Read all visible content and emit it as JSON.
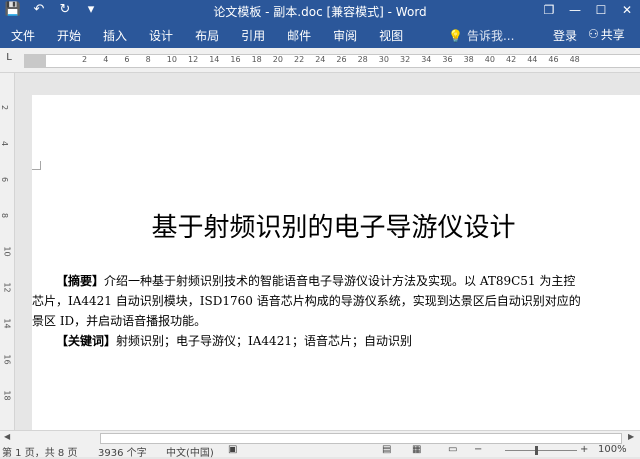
{
  "titlebar": {
    "title": "论文模板 - 副本.doc [兼容模式] - Word",
    "qat": {
      "save_icon": "💾",
      "undo_icon": "↶",
      "redo_icon": "↻",
      "custom_icon": "▾"
    },
    "controls": {
      "restore": "❐",
      "minimize": "—",
      "maximize": "☐",
      "close": "✕"
    }
  },
  "ribbon": {
    "tabs": [
      "文件",
      "开始",
      "插入",
      "设计",
      "布局",
      "引用",
      "邮件",
      "审阅",
      "视图"
    ],
    "tell_me": "告诉我...",
    "login": "登录",
    "share": "共享"
  },
  "ruler": {
    "numbers": [
      "2",
      "4",
      "6",
      "8",
      "10",
      "12",
      "14",
      "16",
      "18",
      "20",
      "22",
      "24",
      "26",
      "28",
      "30",
      "32",
      "34",
      "36",
      "38",
      "40",
      "42",
      "44",
      "46",
      "48"
    ],
    "v_numbers": [
      "2",
      "4",
      "6",
      "8",
      "10",
      "12",
      "14",
      "16",
      "18"
    ]
  },
  "document": {
    "title": "基于射频识别的电子导游仪设计",
    "abstract_label": "【摘要】",
    "abstract_line1": "介绍一种基于射频识别技术的智能语音电子导游仪设计方法及实现。以 AT89C51 为主控",
    "abstract_line2": "芯片，IA4421 自动识别模块，ISD1760 语音芯片构成的导游仪系统，实现到达景区后自动识别对应的",
    "abstract_line3": "景区 ID，并启动语音播报功能。",
    "keywords_label": "【关键词】",
    "keywords": "射频识别；电子导游仪；IA4421；语音芯片；自动识别"
  },
  "status": {
    "page": "第 1 页，共 8 页",
    "words": "3936 个字",
    "language": "中文(中国)",
    "zoom": "100%"
  }
}
